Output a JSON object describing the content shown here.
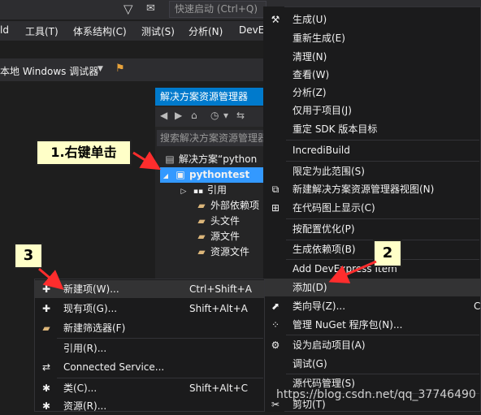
{
  "titlebar": {
    "quick_launch_placeholder": "快速启动 (Ctrl+Q)"
  },
  "menubar": {
    "items": [
      "ld",
      "工具(T)",
      "体系结构(C)",
      "测试(S)",
      "分析(N)",
      "DevE"
    ]
  },
  "toolbar": {
    "debugger": "本地 Windows 调试器"
  },
  "solution_explorer": {
    "title": "解决方案资源管理器",
    "search_placeholder": "搜索解决方案资源管理器",
    "tree": [
      {
        "label": "解决方案“python",
        "icon": "solution-icon"
      },
      {
        "label": "pythontest",
        "icon": "project-icon",
        "selected": true
      },
      {
        "label": "引用",
        "icon": "references-icon"
      },
      {
        "label": "外部依赖项",
        "icon": "folder-icon"
      },
      {
        "label": "头文件",
        "icon": "folder-icon"
      },
      {
        "label": "源文件",
        "icon": "folder-icon"
      },
      {
        "label": "资源文件",
        "icon": "folder-icon"
      }
    ]
  },
  "annotations": {
    "step1": "1.右键单击",
    "step2": "2",
    "step3": "3",
    "colors": {
      "arrow": "#ff2d2d",
      "callout_bg": "#ffffc8"
    }
  },
  "context_menu": {
    "items": [
      {
        "label": "生成(U)",
        "icon": "build-icon"
      },
      {
        "label": "重新生成(E)"
      },
      {
        "label": "清理(N)"
      },
      {
        "label": "查看(W)"
      },
      {
        "label": "分析(Z)"
      },
      {
        "label": "仅用于项目(J)"
      },
      {
        "label": "重定 SDK 版本目标"
      },
      {
        "label": "IncrediBuild"
      },
      {
        "label": "限定为此范围(S)"
      },
      {
        "label": "新建解决方案资源管理器视图(N)",
        "icon": "new-view-icon"
      },
      {
        "label": "在代码图上显示(C)",
        "icon": "code-map-icon"
      },
      {
        "label": "按配置优化(P)"
      },
      {
        "label": "生成依赖项(B)"
      },
      {
        "label": "Add DevExpress Item"
      },
      {
        "label": "添加(D)",
        "highlighted": true
      },
      {
        "label": "类向导(Z)...",
        "icon": "class-wizard-icon",
        "shortcut": "C"
      },
      {
        "label": "管理 NuGet 程序包(N)...",
        "icon": "nuget-icon"
      },
      {
        "label": "设为启动项目(A)",
        "icon": "gear-icon"
      },
      {
        "label": "调试(G)"
      },
      {
        "label": "源代码管理(S)"
      },
      {
        "label": "剪切(T)",
        "icon": "cut-icon"
      }
    ]
  },
  "add_submenu": {
    "items": [
      {
        "label": "新建项(W)...",
        "shortcut": "Ctrl+Shift+A",
        "icon": "new-item-icon",
        "highlighted": true
      },
      {
        "label": "现有项(G)...",
        "shortcut": "Shift+Alt+A",
        "icon": "existing-item-icon"
      },
      {
        "label": "新建筛选器(F)",
        "icon": "new-filter-icon"
      },
      {
        "label": "引用(R)..."
      },
      {
        "label": "Connected Service...",
        "icon": "connected-service-icon"
      },
      {
        "label": "类(C)...",
        "shortcut": "Shift+Alt+C",
        "icon": "class-icon"
      },
      {
        "label": "资源(R)...",
        "icon": "resource-icon"
      }
    ]
  },
  "watermark": "https://blog.csdn.net/qq_37746490"
}
